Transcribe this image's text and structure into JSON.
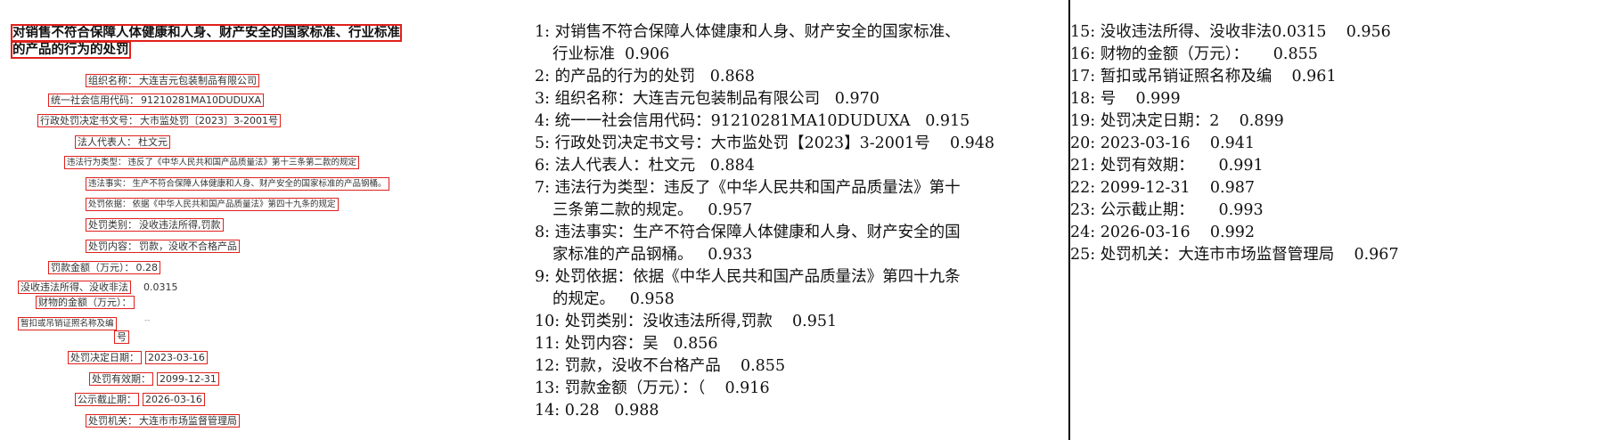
{
  "source": {
    "title_line1": "对销售不符合保障人体健康和人身、财产安全的国家标准、行业标准",
    "title_line2": "的产品的行为的处罚",
    "fields": [
      {
        "key": "组织名称：",
        "value": "大连吉元包装制品有限公司"
      },
      {
        "key": "统一社会信用代码：",
        "value": "91210281MA10DUDUXA"
      },
      {
        "key": "行政处罚决定书文号：",
        "value": "大市监处罚〔2023〕3-2001号"
      },
      {
        "key": "法人代表人：",
        "value": "杜文元"
      },
      {
        "key": "违法行为类型：",
        "value": "违反了《中华人民共和国产品质量法》第十三条第二款的规定"
      },
      {
        "key": "违法事实：",
        "value": "生产不符合保障人体健康和人身、财产安全的国家标准的产品钢桶。"
      },
      {
        "key": "处罚依据：",
        "value": "依据《中华人民共和国产品质量法》第四十九条的规定"
      },
      {
        "key": "处罚类别：",
        "value": "没收违法所得,罚款"
      },
      {
        "key": "处罚内容：",
        "value": "罚款，没收不合格产品"
      },
      {
        "key": "罚款金额（万元）：",
        "value": "0.28"
      },
      {
        "key": "没收违法所得、没收非法",
        "value": "0.0315"
      },
      {
        "key": "财物的金额（万元）：",
        "value": ""
      },
      {
        "key": "暂扣或吊销证照名称及编",
        "value": "--"
      },
      {
        "key": "号",
        "value": ""
      },
      {
        "key": "处罚决定日期：",
        "value": "2023-03-16"
      },
      {
        "key": "处罚有效期：",
        "value": "2099-12-31"
      },
      {
        "key": "公示截止期：",
        "value": "2026-03-16"
      },
      {
        "key": "处罚机关：",
        "value": "大连市市场监督管理局"
      }
    ]
  },
  "ocr_results": {
    "middle": [
      [
        "1: 对销售不符合保障人体健康和人身、财产安全的国家标准、",
        "行业标准  0.906"
      ],
      [
        "2: 的产品的行为的处罚   0.868"
      ],
      [
        "3: 组织名称：大连吉元包装制品有限公司   0.970"
      ],
      [
        "4: 统一一社会信用代码：91210281MA10DUDUXA   0.915"
      ],
      [
        "5: 行政处罚决定书文号：大市监处罚【2023】3-2001号    0.948"
      ],
      [
        "6: 法人代表人：杜文元   0.884"
      ],
      [
        "7: 违法行为类型：违反了《中华人民共和国产品质量法》第十",
        "三条第二款的规定。   0.957"
      ],
      [
        "8: 违法事实：生产不符合保障人体健康和人身、财产安全的国",
        "家标准的产品钢桶。   0.933"
      ],
      [
        "9: 处罚依据：依据《中华人民共和国产品质量法》第四十九条",
        "的规定。   0.958"
      ],
      [
        "10: 处罚类别：没收违法所得,罚款    0.951"
      ],
      [
        "11: 处罚内容：吴   0.856"
      ],
      [
        "12: 罚款，没收不台格产品    0.855"
      ],
      [
        "13: 罚款金额（万元）：（    0.916"
      ],
      [
        "14: 0.28   0.988"
      ]
    ],
    "right": [
      "15: 没收违法所得、没收非法0.0315    0.956",
      "16: 财物的金额（万元）：     0.855",
      "17: 暂扣或吊销证照名称及编    0.961",
      "18: 号    0.999",
      "19: 处罚决定日期：2    0.899",
      "20: 2023-03-16    0.941",
      "21: 处罚有效期：     0.991",
      "22: 2099-12-31    0.987",
      "23: 公示截止期：     0.993",
      "24: 2026-03-16    0.992",
      "25: 处罚机关：大连市市场监督管理局    0.967"
    ]
  },
  "colors": {
    "detection_box": "#e0201c",
    "divider": "#000000"
  }
}
